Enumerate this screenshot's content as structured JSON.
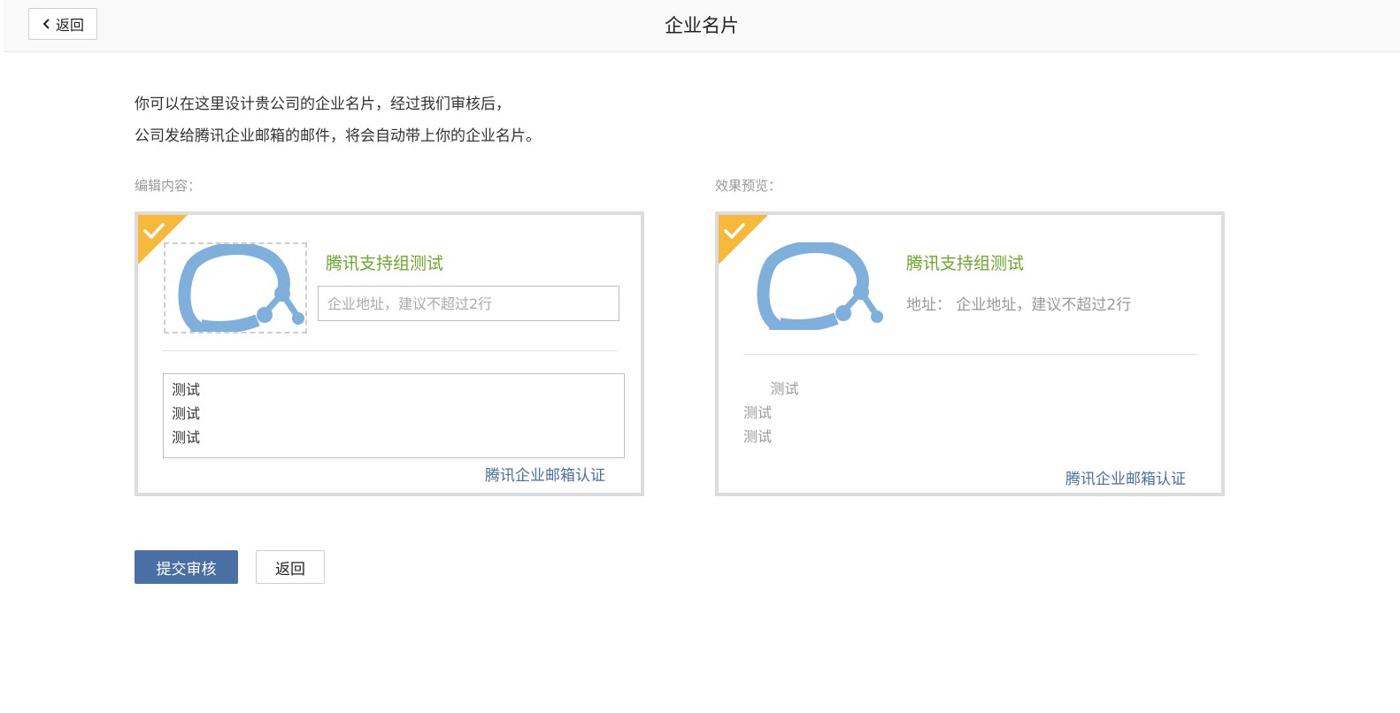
{
  "header": {
    "back_label": "返回",
    "title": "企业名片"
  },
  "intro": {
    "line1": "你可以在这里设计贵公司的企业名片，经过我们审核后，",
    "line2": "公司发给腾讯企业邮箱的邮件，将会自动带上你的企业名片。"
  },
  "editor": {
    "label": "编辑内容：",
    "company_name": "腾讯支持组测试",
    "address_value": "",
    "address_placeholder": "企业地址，建议不超过2行",
    "body_lines": [
      "测试",
      "测试",
      "测试"
    ],
    "verify_link": "腾讯企业邮箱认证"
  },
  "preview": {
    "label": "效果预览：",
    "company_name": "腾讯支持组测试",
    "address_prefix": "地址：",
    "address_text": "企业地址，建议不超过2行",
    "body_lines": [
      "      测试",
      "测试",
      "测试"
    ],
    "verify_link": "腾讯企业邮箱认证"
  },
  "actions": {
    "submit_label": "提交审核",
    "cancel_label": "返回"
  },
  "colors": {
    "accent_blue": "#4a6fa5",
    "company_green": "#6aa928",
    "corner_yellow": "#f6b93b",
    "logo_blue": "#7fb0dc"
  }
}
